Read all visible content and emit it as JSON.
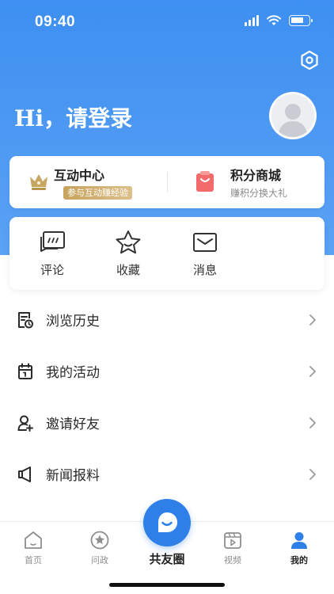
{
  "status_bar": {
    "time": "09:40"
  },
  "header": {
    "greeting": "Hi，请登录"
  },
  "promo_cards": [
    {
      "title": "互动中心",
      "subtitle": "参与互动赚经验",
      "icon": "crown-icon"
    },
    {
      "title": "积分商城",
      "subtitle": "赚积分换大礼",
      "icon": "shopping-bag-icon"
    }
  ],
  "quick_actions": [
    {
      "label": "评论",
      "icon": "comment-icon"
    },
    {
      "label": "收藏",
      "icon": "star-icon"
    },
    {
      "label": "消息",
      "icon": "mail-icon"
    }
  ],
  "menu": [
    {
      "label": "浏览历史",
      "icon": "history-icon"
    },
    {
      "label": "我的活动",
      "icon": "calendar-icon"
    },
    {
      "label": "邀请好友",
      "icon": "add-user-icon"
    },
    {
      "label": "新闻报料",
      "icon": "megaphone-icon"
    }
  ],
  "tabbar": {
    "tabs": [
      {
        "label": "首页",
        "icon": "home-icon"
      },
      {
        "label": "问政",
        "icon": "star-circle-icon"
      },
      {
        "label": "视频",
        "icon": "video-icon"
      },
      {
        "label": "我的",
        "icon": "person-icon",
        "active": true
      }
    ],
    "center": {
      "label": "共友圈",
      "icon": "chat-bubble-icon"
    }
  },
  "colors": {
    "primary": "#2f7fe8",
    "hero": "#4a96f2",
    "gold": "#c7a35e",
    "red": "#f05a5a"
  }
}
